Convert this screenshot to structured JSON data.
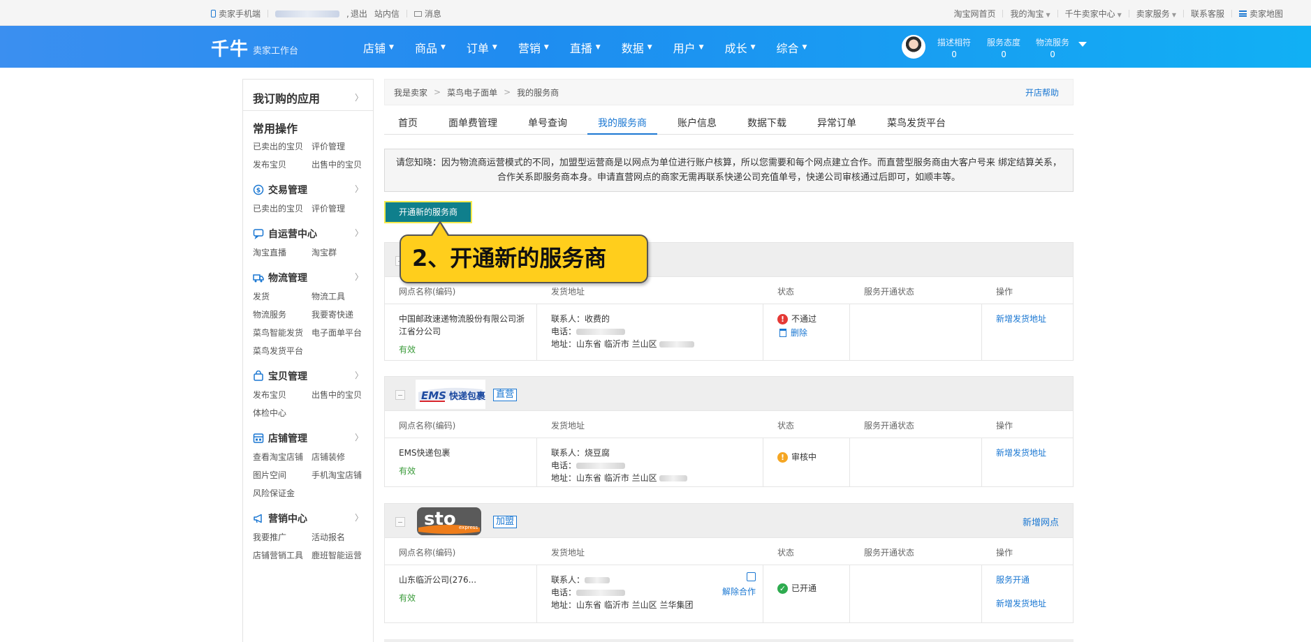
{
  "topbar": {
    "mobile": "卖家手机端",
    "logout": "退出",
    "inbox": "站内信",
    "messages": "消息",
    "right_links": [
      "淘宝网首页",
      "我的淘宝",
      "千牛卖家中心",
      "卖家服务",
      "联系客服",
      "卖家地图"
    ]
  },
  "header": {
    "logo": "千牛",
    "logo_sub": "卖家工作台",
    "nav": [
      "店铺",
      "商品",
      "订单",
      "营销",
      "直播",
      "数据",
      "用户",
      "成长",
      "综合"
    ],
    "scores": [
      {
        "label": "描述相符",
        "value": "0"
      },
      {
        "label": "服务态度",
        "value": "0"
      },
      {
        "label": "物流服务",
        "value": "0"
      }
    ]
  },
  "sidebar": {
    "my_apps": "我订购的应用",
    "common_ops": "常用操作",
    "common_links": [
      "已卖出的宝贝",
      "评价管理",
      "发布宝贝",
      "出售中的宝贝"
    ],
    "sections": [
      {
        "title": "交易管理",
        "icon": "trade-icon",
        "links": [
          "已卖出的宝贝",
          "评价管理"
        ]
      },
      {
        "title": "自运营中心",
        "icon": "chat-icon",
        "links": [
          "淘宝直播",
          "淘宝群"
        ]
      },
      {
        "title": "物流管理",
        "icon": "truck-icon",
        "links": [
          "发货",
          "物流工具",
          "物流服务",
          "我要寄快递",
          "菜鸟智能发货",
          "电子面单平台",
          "菜鸟发货平台"
        ]
      },
      {
        "title": "宝贝管理",
        "icon": "bag-icon",
        "links": [
          "发布宝贝",
          "出售中的宝贝",
          "体检中心"
        ]
      },
      {
        "title": "店铺管理",
        "icon": "store-icon",
        "links": [
          "查看淘宝店铺",
          "店铺装修",
          "图片空间",
          "手机淘宝店铺",
          "风险保证金"
        ]
      },
      {
        "title": "营销中心",
        "icon": "megaphone-icon",
        "links": [
          "我要推广",
          "活动报名",
          "店铺营销工具",
          "鹿班智能运营"
        ]
      }
    ]
  },
  "main": {
    "breadcrumb": [
      "我是卖家",
      "菜鸟电子面单",
      "我的服务商"
    ],
    "help": "开店帮助",
    "tabs": [
      "首页",
      "面单费管理",
      "单号查询",
      "我的服务商",
      "账户信息",
      "数据下载",
      "异常订单",
      "菜鸟发货平台"
    ],
    "active_tab": "我的服务商",
    "notice": "请您知晓：因为物流商运营模式的不同，加盟型运营商是以网点为单位进行账户核算，所以您需要和每个网点建立合作。而直营型服务商由大客户号来 绑定结算关系，合作关系即服务商本身。申请直营网点的商家无需再联系快递公司充值单号，快递公司审核通过后即可，如顺丰等。",
    "open_button": "开通新的服务商",
    "callout": "2、开通新的服务商",
    "columns": [
      "网点名称(编码)",
      "发货地址",
      "状态",
      "服务开通状态",
      "操作"
    ],
    "providers": [
      {
        "badge": "",
        "add_node": "",
        "name": "中国邮政速递物流股份有限公司浙江省分公司",
        "valid": "有效",
        "contact": "联系人：收费的",
        "phone": "电话：",
        "address": "地址：山东省 临沂市 兰山区",
        "status": "不通过",
        "status_extra": "删除",
        "op": [
          "新增发货地址"
        ]
      },
      {
        "badge": "直营",
        "add_node": "",
        "name": "EMS快递包裹",
        "valid": "有效",
        "contact": "联系人：烧豆腐",
        "phone": "电话：",
        "address": "地址：山东省 临沂市 兰山区",
        "status": "审核中",
        "status_extra": "",
        "op": [
          "新增发货地址"
        ]
      },
      {
        "badge": "加盟",
        "add_node": "新增网点",
        "name": "山东临沂公司(276...",
        "valid": "有效",
        "contact": "联系人：",
        "phone": "电话：",
        "address": "地址：山东省 临沂市 兰山区 兰华集团",
        "status": "已开通",
        "status_extra": "",
        "cancel": "解除合作",
        "op": [
          "服务开通",
          "新增发货地址"
        ]
      }
    ],
    "ems_logo_text": "EMS",
    "ems_logo_cn": "快递包裹",
    "sto_logo_text": "sto",
    "sto_logo_sub": "express"
  },
  "colors": {
    "header_start": "#3b8ff0",
    "header_end": "#11b0f4",
    "link": "#1a77d2",
    "open_button": "#0f7f8c",
    "callout": "#ffce1c",
    "valid": "#3a9b3a",
    "reject": "#e53935",
    "pending": "#f5a623",
    "ok": "#2eab4f"
  }
}
